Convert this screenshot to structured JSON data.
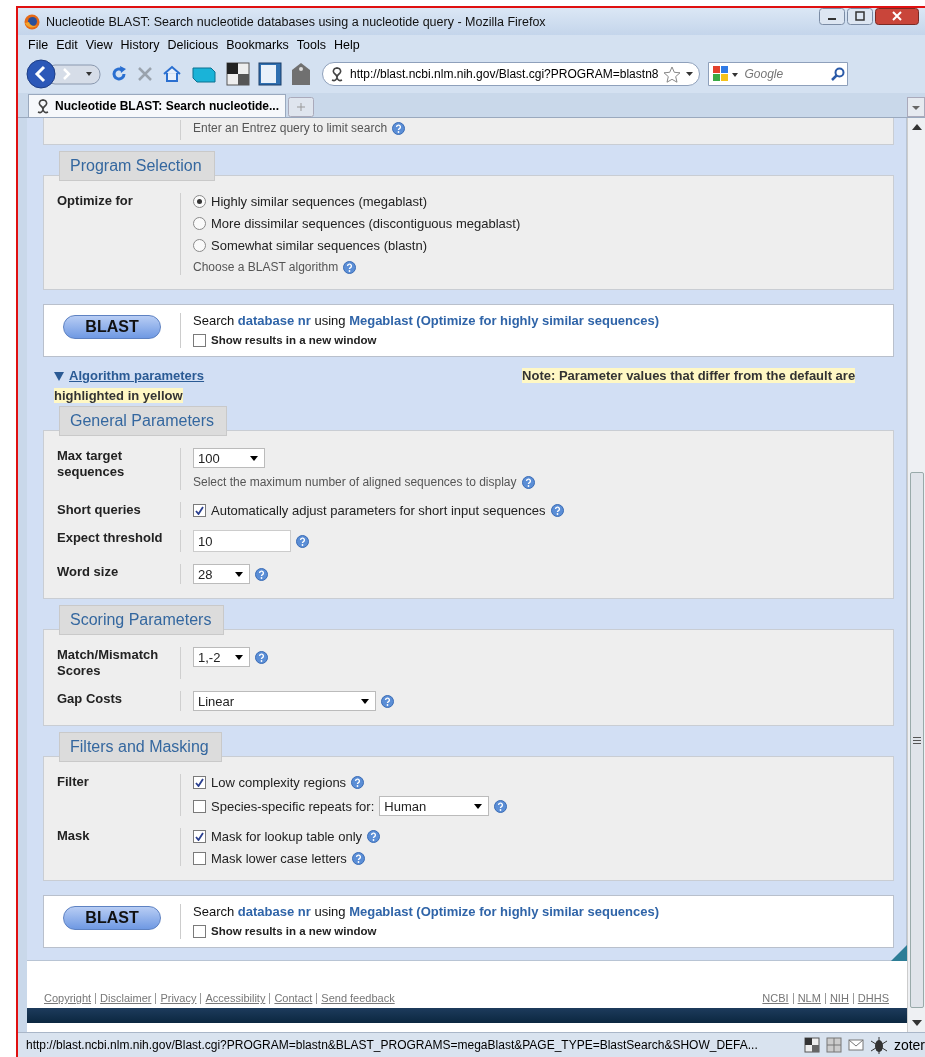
{
  "window": {
    "title": "Nucleotide BLAST: Search nucleotide databases using a nucleotide query - Mozilla Firefox"
  },
  "menu": [
    "File",
    "Edit",
    "View",
    "History",
    "Delicious",
    "Bookmarks",
    "Tools",
    "Help"
  ],
  "address_bar": {
    "value": "http://blast.ncbi.nlm.nih.gov/Blast.cgi?PROGRAM=blastn8"
  },
  "search_bar": {
    "placeholder": "Google"
  },
  "tabs": [
    {
      "label": "Nucleotide BLAST: Search nucleotide...",
      "selected": true
    }
  ],
  "content": [
    {
      "kind": "partial",
      "rows": [
        {
          "lines": [
            {
              "items": [
                {
                  "kind": "hint",
                  "text": "Enter an Entrez query to limit search",
                  "help": true
                }
              ]
            }
          ]
        }
      ]
    },
    {
      "kind": "panel",
      "title": "Program Selection",
      "rows": [
        {
          "label": "Optimize for",
          "lines": [
            {
              "items": [
                {
                  "kind": "radio",
                  "text": "Highly similar sequences (megablast)",
                  "selected": true
                }
              ]
            },
            {
              "items": [
                {
                  "kind": "radio",
                  "text": "More dissimilar sequences (discontiguous megablast)",
                  "selected": false
                }
              ]
            },
            {
              "items": [
                {
                  "kind": "radio",
                  "text": "Somewhat similar sequences (blastn)",
                  "selected": false
                }
              ]
            },
            {
              "items": [
                {
                  "kind": "hint",
                  "text": "Choose a BLAST algorithm",
                  "help": true
                }
              ]
            }
          ]
        }
      ]
    },
    {
      "kind": "blast",
      "button": "BLAST",
      "summary": [
        {
          "kind": "plain",
          "text": "Search"
        },
        {
          "kind": "link",
          "text": "database nr"
        },
        {
          "kind": "plain",
          "text": "using"
        },
        {
          "kind": "link",
          "text": "Megablast (Optimize for highly similar sequences)"
        }
      ],
      "new_window": {
        "text": "Show results in a new window",
        "checked": false
      }
    },
    {
      "kind": "toggle",
      "label": "Algorithm parameters",
      "expanded": true,
      "note": "Note: Parameter values that differ from the default are highlighted in yellow"
    },
    {
      "kind": "panel",
      "title": "General Parameters",
      "rows": [
        {
          "label": "Max target sequences",
          "lines": [
            {
              "items": [
                {
                  "kind": "select",
                  "value": "100"
                }
              ]
            },
            {
              "items": [
                {
                  "kind": "hint",
                  "text": "Select the maximum number of aligned sequences to display",
                  "help": true
                }
              ]
            }
          ]
        },
        {
          "label": "Short queries",
          "lines": [
            {
              "items": [
                {
                  "kind": "checkbox",
                  "text": "Automatically adjust parameters for short input sequences",
                  "checked": true,
                  "help": true
                }
              ]
            }
          ]
        },
        {
          "label": "Expect threshold",
          "lines": [
            {
              "items": [
                {
                  "kind": "text",
                  "value": "10",
                  "help": true
                }
              ]
            }
          ]
        },
        {
          "label": "Word size",
          "lines": [
            {
              "items": [
                {
                  "kind": "select",
                  "value": "28",
                  "help": true
                }
              ]
            }
          ]
        }
      ]
    },
    {
      "kind": "panel",
      "title": "Scoring Parameters",
      "rows": [
        {
          "label": "Match/Mismatch Scores",
          "lines": [
            {
              "items": [
                {
                  "kind": "select",
                  "value": "1,-2",
                  "help": true
                }
              ]
            }
          ]
        },
        {
          "label": "Gap Costs",
          "lines": [
            {
              "items": [
                {
                  "kind": "select",
                  "value": "Linear",
                  "help": true
                }
              ]
            }
          ]
        }
      ]
    },
    {
      "kind": "panel",
      "title": "Filters and Masking",
      "rows": [
        {
          "label": "Filter",
          "lines": [
            {
              "items": [
                {
                  "kind": "checkbox",
                  "text": "Low complexity regions",
                  "checked": true,
                  "help": true
                }
              ]
            },
            {
              "items": [
                {
                  "kind": "checkbox",
                  "text": "Species-specific repeats for:",
                  "checked": false
                },
                {
                  "kind": "select",
                  "value": "Human",
                  "help": true
                }
              ]
            }
          ]
        },
        {
          "label": "Mask",
          "lines": [
            {
              "items": [
                {
                  "kind": "checkbox",
                  "text": "Mask for lookup table only",
                  "checked": true,
                  "help": true
                }
              ]
            },
            {
              "items": [
                {
                  "kind": "checkbox",
                  "text": "Mask lower case letters",
                  "checked": false,
                  "help": true
                }
              ]
            }
          ]
        }
      ]
    },
    {
      "kind": "blast",
      "button": "BLAST",
      "summary": [
        {
          "kind": "plain",
          "text": "Search"
        },
        {
          "kind": "link",
          "text": "database nr"
        },
        {
          "kind": "plain",
          "text": "using"
        },
        {
          "kind": "link",
          "text": "Megablast (Optimize for highly similar sequences)"
        }
      ],
      "new_window": {
        "text": "Show results in a new window",
        "checked": false
      }
    }
  ],
  "footer": {
    "left": [
      "Copyright",
      "Disclaimer",
      "Privacy",
      "Accessibility",
      "Contact",
      "Send feedback"
    ],
    "right": [
      "NCBI",
      "NLM",
      "NIH",
      "DHHS"
    ]
  },
  "status_bar": {
    "text": "http://blast.ncbi.nlm.nih.gov/Blast.cgi?PROGRAM=blastn&BLAST_PROGRAMS=megaBlast&PAGE_TYPE=BlastSearch&SHOW_DEFA...",
    "addon": "zoter"
  }
}
